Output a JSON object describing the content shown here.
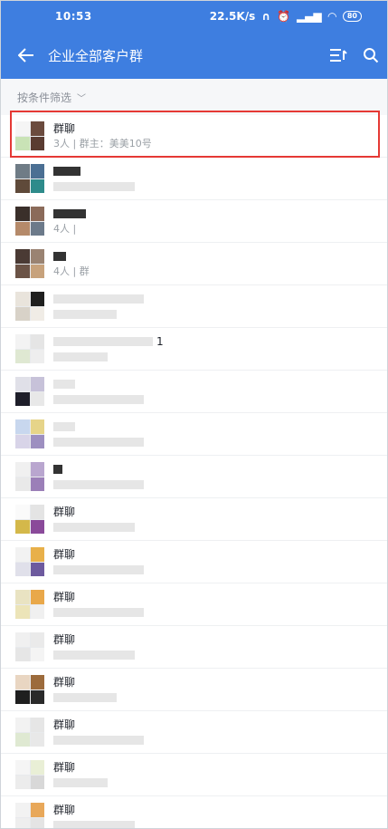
{
  "status_bar": {
    "time": "10:53",
    "network_speed": "22.5K/s",
    "battery": "80"
  },
  "header": {
    "title": "企业全部客户群"
  },
  "filter": {
    "label": "按条件筛选"
  },
  "rows": [
    {
      "name": "群聊",
      "sub": "3人 | 群主：美美10号"
    },
    {
      "name": "",
      "sub": ""
    },
    {
      "name": "",
      "sub": "4人 |"
    },
    {
      "name": "",
      "sub": "4人 | 群"
    },
    {
      "name": "",
      "sub": ""
    },
    {
      "name": "1",
      "sub": ""
    },
    {
      "name": "",
      "sub": ""
    },
    {
      "name": "",
      "sub": ""
    },
    {
      "name": "",
      "sub": ""
    },
    {
      "name": "群聊",
      "sub": ""
    },
    {
      "name": "群聊",
      "sub": ""
    },
    {
      "name": "群聊",
      "sub": ""
    },
    {
      "name": "群聊",
      "sub": ""
    },
    {
      "name": "群聊",
      "sub": ""
    },
    {
      "name": "群聊",
      "sub": ""
    },
    {
      "name": "群聊",
      "sub": ""
    },
    {
      "name": "群聊",
      "sub": ""
    }
  ]
}
